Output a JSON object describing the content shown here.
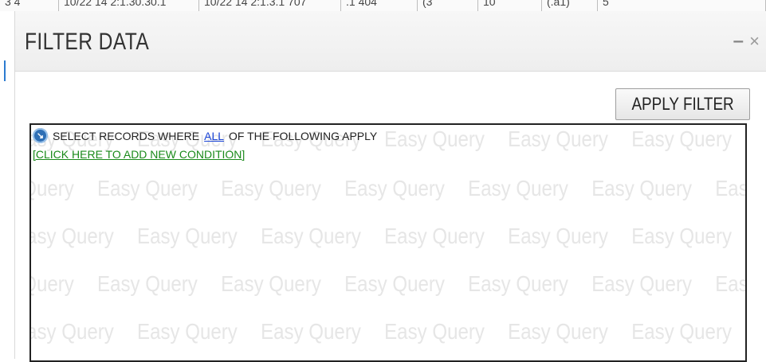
{
  "background_table": {
    "cells": [
      "3 4",
      "10/22 14 2:1.30.30.1",
      "10/22 14 2:1.3.1 707",
      ".1 404",
      "(3",
      "10",
      "(.a1)",
      "5"
    ]
  },
  "dialog": {
    "title": "FILTER DATA",
    "minimize_label": "–",
    "close_label": "×",
    "apply_button_label": "APPLY FILTER"
  },
  "query": {
    "prefix": "SELECT RECORDS WHERE",
    "link_label": "ALL",
    "suffix": "OF THE FOLLOWING APPLY",
    "add_condition_label": "[CLICK HERE TO ADD NEW CONDITION]",
    "icon": "query-menu-icon",
    "watermark_text": "Easy Query"
  },
  "colors": {
    "link_blue": "#1a44d6",
    "add_link_green": "#1a8a1a",
    "icon_blue": "#2f6fb5",
    "watermark": "#e6e6e6"
  }
}
